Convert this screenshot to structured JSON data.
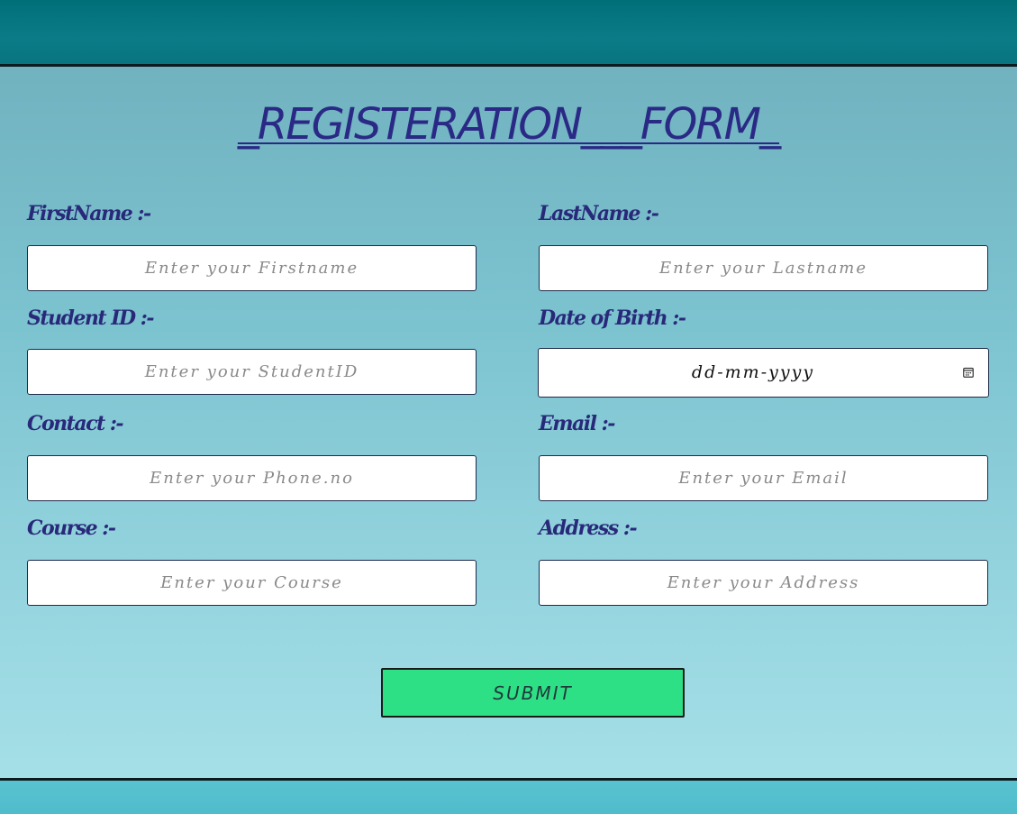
{
  "title": "_REGISTERATION___FORM_",
  "fields": {
    "first_name": {
      "label": "FirstName :-",
      "placeholder": "Enter your Firstname",
      "value": ""
    },
    "last_name": {
      "label": "LastName :-",
      "placeholder": "Enter your Lastname",
      "value": ""
    },
    "student_id": {
      "label": "Student ID :-",
      "placeholder": "Enter your StudentID",
      "value": ""
    },
    "dob": {
      "label": "Date of Birth :-",
      "display": "dd-mm-yyyy"
    },
    "contact": {
      "label": "Contact :-",
      "placeholder": "Enter your Phone.no",
      "value": ""
    },
    "email": {
      "label": "Email :-",
      "placeholder": "Enter your Email",
      "value": ""
    },
    "course": {
      "label": "Course :-",
      "placeholder": "Enter your Course",
      "value": ""
    },
    "address": {
      "label": "Address :-",
      "placeholder": "Enter your Address",
      "value": ""
    }
  },
  "submit_label": "SUBMIT",
  "icons": {
    "date_picker": "calendar-icon"
  },
  "colors": {
    "title": "#2a2a86",
    "label": "#29297a",
    "submit_bg": "#2ee085",
    "header_band": "#00737d"
  }
}
